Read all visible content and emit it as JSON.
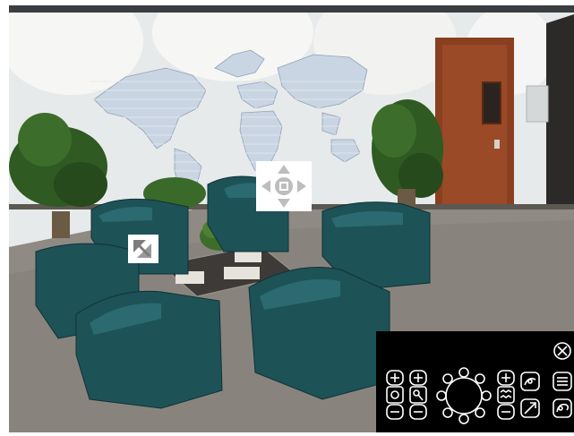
{
  "camera_view": {
    "scene": "lobby-camera-feed",
    "colors": {
      "wall": "#e9ecec",
      "map": "#c9d5e3",
      "door": "#8a3f20",
      "carpet": "#8f8a84",
      "chair": "#1d5257",
      "plant": "#2f5a22"
    }
  },
  "overlays": {
    "pan_widget_icon": "pan-arrows-icon",
    "corner_widget_icon": "diagonal-resize-icon"
  },
  "control_panel": {
    "background": "#000000",
    "stroke": "#ffffff",
    "icons": [
      "zoom-in-plus-icon",
      "zoom-level-icon",
      "zoom-out-minus-icon",
      "focus-plus-icon",
      "focus-icon",
      "focus-minus-icon",
      "direction-wheel-icon",
      "iris-plus-icon",
      "iris-icon",
      "iris-minus-icon",
      "close-icon",
      "preset-icon",
      "menu-icon",
      "snapshot-icon",
      "settings-icon"
    ]
  }
}
